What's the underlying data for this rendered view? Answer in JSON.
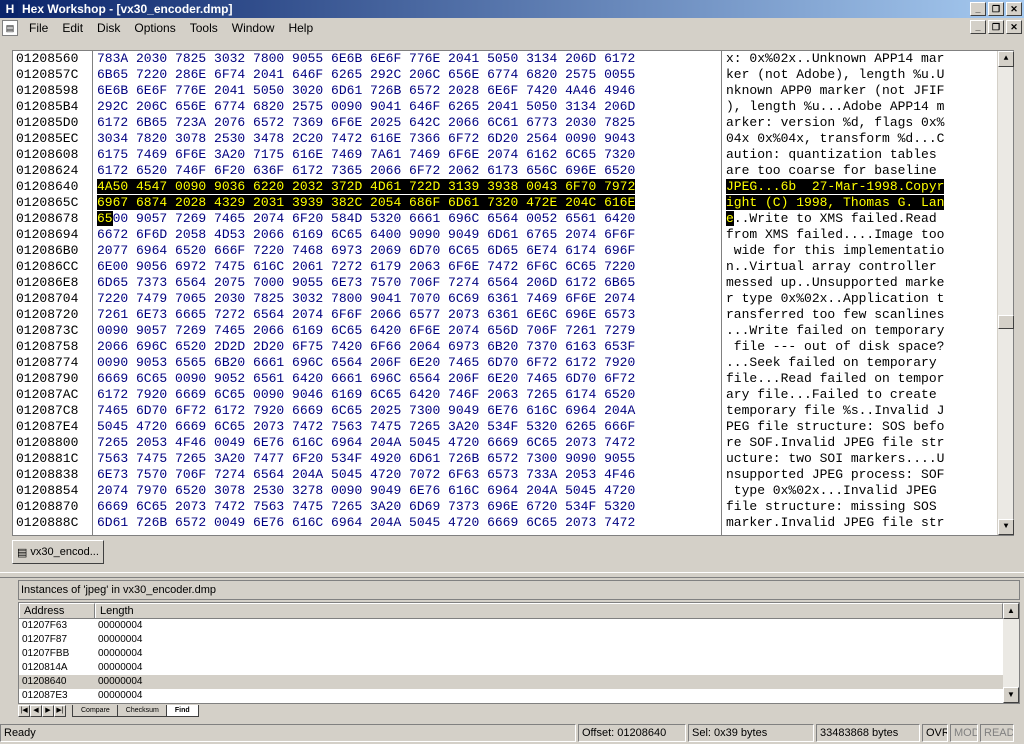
{
  "app": {
    "title": "Hex Workshop - [vx30_encoder.dmp]",
    "icon_letter": "H"
  },
  "menu": [
    "File",
    "Edit",
    "Disk",
    "Options",
    "Tools",
    "Window",
    "Help"
  ],
  "hex_rows": [
    {
      "addr": "01208560",
      "hex": "783A 2030 7825 3032 7800 9055 6E6B 6E6F 776E 2041 5050 3134 206D 6172",
      "ascii": "x: 0x%02x..Unknown APP14 mar"
    },
    {
      "addr": "0120857C",
      "hex": "6B65 7220 286E 6F74 2041 646F 6265 292C 206C 656E 6774 6820 2575 0055",
      "ascii": "ker (not Adobe), length %u.U"
    },
    {
      "addr": "01208598",
      "hex": "6E6B 6E6F 776E 2041 5050 3020 6D61 726B 6572 2028 6E6F 7420 4A46 4946",
      "ascii": "nknown APP0 marker (not JFIF"
    },
    {
      "addr": "012085B4",
      "hex": "292C 206C 656E 6774 6820 2575 0090 9041 646F 6265 2041 5050 3134 206D",
      "ascii": "), length %u...Adobe APP14 m"
    },
    {
      "addr": "012085D0",
      "hex": "6172 6B65 723A 2076 6572 7369 6F6E 2025 642C 2066 6C61 6773 2030 7825",
      "ascii": "arker: version %d, flags 0x%"
    },
    {
      "addr": "012085EC",
      "hex": "3034 7820 3078 2530 3478 2C20 7472 616E 7366 6F72 6D20 2564 0090 9043",
      "ascii": "04x 0x%04x, transform %d...C"
    },
    {
      "addr": "01208608",
      "hex": "6175 7469 6F6E 3A20 7175 616E 7469 7A61 7469 6F6E 2074 6162 6C65 7320",
      "ascii": "aution: quantization tables "
    },
    {
      "addr": "01208624",
      "hex": "6172 6520 746F 6F20 636F 6172 7365 2066 6F72 2062 6173 656C 696E 6520",
      "ascii": "are too coarse for baseline "
    },
    {
      "addr": "01208640",
      "hex": "4A50 4547 0090 9036 6220 2032 372D 4D61 722D 3139 3938 0043 6F70 7972",
      "ascii": "JPEG...6b  27-Mar-1998.Copyr",
      "sel": "full"
    },
    {
      "addr": "0120865C",
      "hex": "6967 6874 2028 4329 2031 3939 382C 2054 686F 6D61 7320 472E 204C 616E",
      "ascii": "ight (C) 1998, Thomas G. Lan",
      "sel": "full"
    },
    {
      "addr": "01208678",
      "hex": "6500 9057 7269 7465 2074 6F20 584D 5320 6661 696C 6564 0052 6561 6420",
      "ascii": "e..Write to XMS failed.Read ",
      "sel": "first"
    },
    {
      "addr": "01208694",
      "hex": "6672 6F6D 2058 4D53 2066 6169 6C65 6400 9090 9049 6D61 6765 2074 6F6F",
      "ascii": "from XMS failed....Image too"
    },
    {
      "addr": "012086B0",
      "hex": "2077 6964 6520 666F 7220 7468 6973 2069 6D70 6C65 6D65 6E74 6174 696F",
      "ascii": " wide for this implementatio"
    },
    {
      "addr": "012086CC",
      "hex": "6E00 9056 6972 7475 616C 2061 7272 6179 2063 6F6E 7472 6F6C 6C65 7220",
      "ascii": "n..Virtual array controller "
    },
    {
      "addr": "012086E8",
      "hex": "6D65 7373 6564 2075 7000 9055 6E73 7570 706F 7274 6564 206D 6172 6B65",
      "ascii": "messed up..Unsupported marke"
    },
    {
      "addr": "01208704",
      "hex": "7220 7479 7065 2030 7825 3032 7800 9041 7070 6C69 6361 7469 6F6E 2074",
      "ascii": "r type 0x%02x..Application t"
    },
    {
      "addr": "01208720",
      "hex": "7261 6E73 6665 7272 6564 2074 6F6F 2066 6577 2073 6361 6E6C 696E 6573",
      "ascii": "ransferred too few scanlines"
    },
    {
      "addr": "0120873C",
      "hex": "0090 9057 7269 7465 2066 6169 6C65 6420 6F6E 2074 656D 706F 7261 7279",
      "ascii": "...Write failed on temporary"
    },
    {
      "addr": "01208758",
      "hex": "2066 696C 6520 2D2D 2D20 6F75 7420 6F66 2064 6973 6B20 7370 6163 653F",
      "ascii": " file --- out of disk space?"
    },
    {
      "addr": "01208774",
      "hex": "0090 9053 6565 6B20 6661 696C 6564 206F 6E20 7465 6D70 6F72 6172 7920",
      "ascii": "...Seek failed on temporary "
    },
    {
      "addr": "01208790",
      "hex": "6669 6C65 0090 9052 6561 6420 6661 696C 6564 206F 6E20 7465 6D70 6F72",
      "ascii": "file...Read failed on tempor"
    },
    {
      "addr": "012087AC",
      "hex": "6172 7920 6669 6C65 0090 9046 6169 6C65 6420 746F 2063 7265 6174 6520",
      "ascii": "ary file...Failed to create "
    },
    {
      "addr": "012087C8",
      "hex": "7465 6D70 6F72 6172 7920 6669 6C65 2025 7300 9049 6E76 616C 6964 204A",
      "ascii": "temporary file %s..Invalid J"
    },
    {
      "addr": "012087E4",
      "hex": "5045 4720 6669 6C65 2073 7472 7563 7475 7265 3A20 534F 5320 6265 666F",
      "ascii": "PEG file structure: SOS befo"
    },
    {
      "addr": "01208800",
      "hex": "7265 2053 4F46 0049 6E76 616C 6964 204A 5045 4720 6669 6C65 2073 7472",
      "ascii": "re SOF.Invalid JPEG file str"
    },
    {
      "addr": "0120881C",
      "hex": "7563 7475 7265 3A20 7477 6F20 534F 4920 6D61 726B 6572 7300 9090 9055",
      "ascii": "ucture: two SOI markers....U"
    },
    {
      "addr": "01208838",
      "hex": "6E73 7570 706F 7274 6564 204A 5045 4720 7072 6F63 6573 733A 2053 4F46",
      "ascii": "nsupported JPEG process: SOF"
    },
    {
      "addr": "01208854",
      "hex": "2074 7970 6520 3078 2530 3278 0090 9049 6E76 616C 6964 204A 5045 4720",
      "ascii": " type 0x%02x...Invalid JPEG "
    },
    {
      "addr": "01208870",
      "hex": "6669 6C65 2073 7472 7563 7475 7265 3A20 6D69 7373 696E 6720 534F 5320",
      "ascii": "file structure: missing SOS "
    },
    {
      "addr": "0120888C",
      "hex": "6D61 726B 6572 0049 6E76 616C 6964 204A 5045 4720 6669 6C65 2073 7472",
      "ascii": "marker.Invalid JPEG file str"
    }
  ],
  "doc_tab": {
    "label": "vx30_encod..."
  },
  "find": {
    "header": "Instances of 'jpeg' in vx30_encoder.dmp",
    "col_address": "Address",
    "col_length": "Length",
    "rows": [
      {
        "address": "01207F63",
        "length": "00000004"
      },
      {
        "address": "01207F87",
        "length": "00000004"
      },
      {
        "address": "01207FBB",
        "length": "00000004"
      },
      {
        "address": "0120814A",
        "length": "00000004"
      },
      {
        "address": "01208640",
        "length": "00000004",
        "highlight": true
      },
      {
        "address": "012087E3",
        "length": "00000004"
      }
    ]
  },
  "bottom_tabs": [
    "Compare",
    "Checksum",
    "Find"
  ],
  "status": {
    "ready": "Ready",
    "offset": "Offset: 01208640",
    "sel": "Sel: 0x39 bytes",
    "size": "33483868 bytes",
    "ovr": "OVR",
    "mod": "MOD",
    "read": "READ"
  }
}
